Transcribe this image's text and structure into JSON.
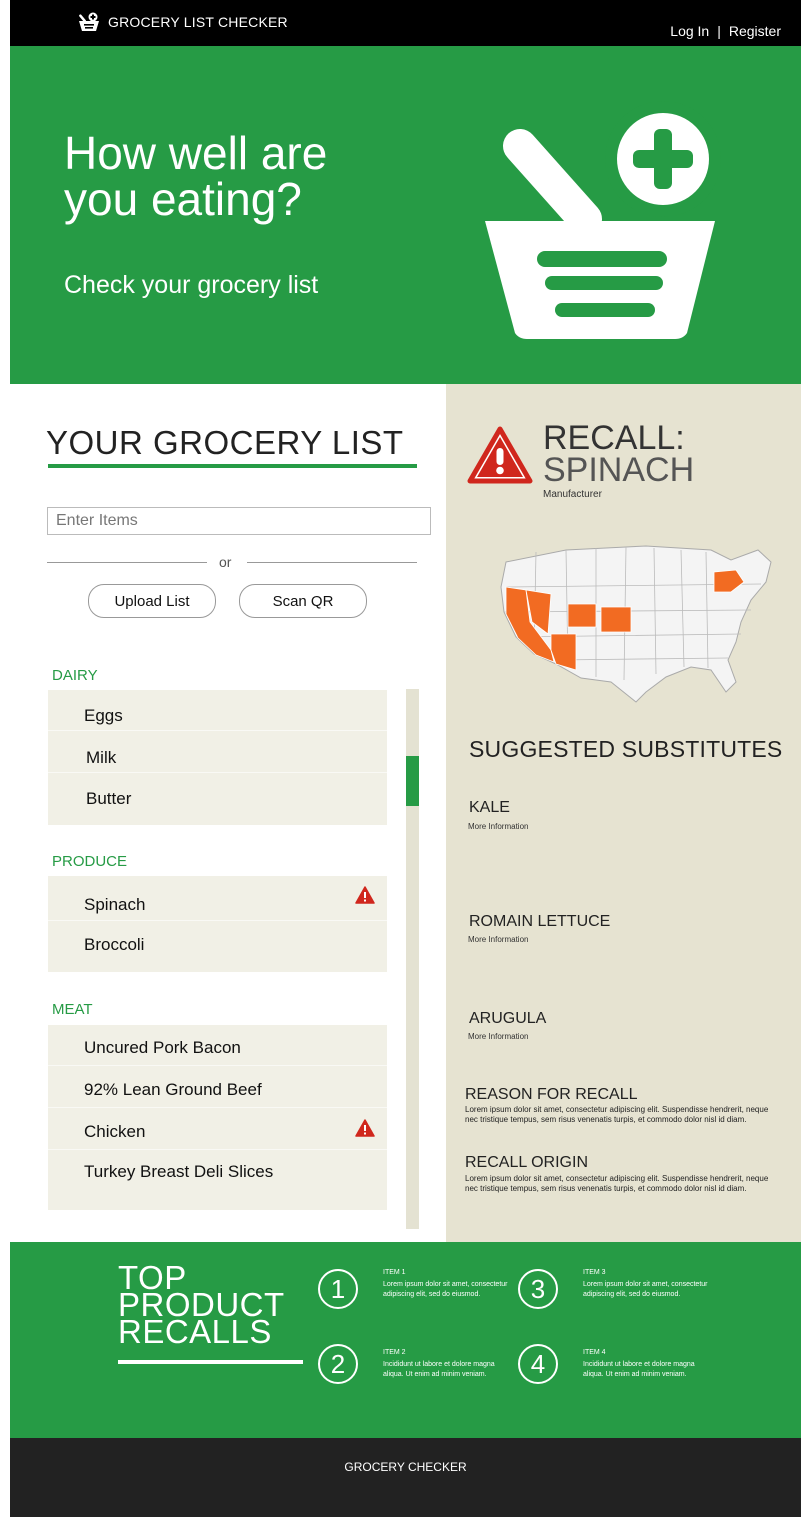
{
  "header": {
    "brand": "GROCERY LIST CHECKER",
    "login": "Log In",
    "separator": "|",
    "register": "Register"
  },
  "hero": {
    "title": "How well are\nyou eating?",
    "subtitle": "Check your grocery list"
  },
  "list": {
    "title": "YOUR GROCERY LIST",
    "search_placeholder": "Enter Items",
    "or": "or",
    "upload": "Upload List",
    "scan": "Scan QR",
    "categories": [
      {
        "name": "DAIRY",
        "items": [
          "Eggs",
          "Milk",
          "Butter"
        ]
      },
      {
        "name": "PRODUCE",
        "items": [
          "Spinach",
          "Broccoli"
        ]
      },
      {
        "name": "MEAT",
        "items": [
          "Uncured Pork Bacon",
          "92% Lean Ground Beef",
          "Chicken",
          "Turkey Breast Deli Slices"
        ]
      }
    ]
  },
  "recall": {
    "label": "RECALL:",
    "product": "SPINACH",
    "manufacturer": "Manufacturer",
    "substitutes_title": "SUGGESTED SUBSTITUTES",
    "substitutes": [
      {
        "name": "KALE",
        "more": "More Information"
      },
      {
        "name": "ROMAIN LETTUCE",
        "more": "More Information"
      },
      {
        "name": "ARUGULA",
        "more": "More Information"
      }
    ],
    "reason_title": "REASON FOR RECALL",
    "reason_text": "Lorem ipsum dolor sit amet, consectetur adipiscing elit. Suspendisse hendrerit, neque nec tristique tempus, sem risus venenatis turpis, et commodo dolor nisl id diam.",
    "origin_title": "RECALL ORIGIN",
    "origin_text": "Lorem ipsum dolor sit amet, consectetur adipiscing elit. Suspendisse hendrerit, neque nec tristique tempus, sem risus venenatis turpis, et commodo dolor nisl id diam."
  },
  "top_recalls": {
    "title": "TOP\nPRODUCT\nRECALLS",
    "items": [
      {
        "num": "1",
        "head": "ITEM 1",
        "text": "Lorem ipsum dolor sit amet, consectetur adipiscing elit, sed do eiusmod."
      },
      {
        "num": "2",
        "head": "ITEM 2",
        "text": "Incididunt ut labore et dolore magna aliqua. Ut enim ad minim veniam."
      },
      {
        "num": "3",
        "head": "ITEM 3",
        "text": "Lorem ipsum dolor sit amet, consectetur adipiscing elit, sed do eiusmod."
      },
      {
        "num": "4",
        "head": "ITEM 4",
        "text": "Incididunt ut labore et dolore magna aliqua. Ut enim ad minim veniam."
      }
    ]
  },
  "footer": {
    "text": "GROCERY CHECKER"
  },
  "colors": {
    "green": "#269b45",
    "beige": "#e6e3d1",
    "orange": "#f26b22",
    "red": "#d0271d"
  }
}
